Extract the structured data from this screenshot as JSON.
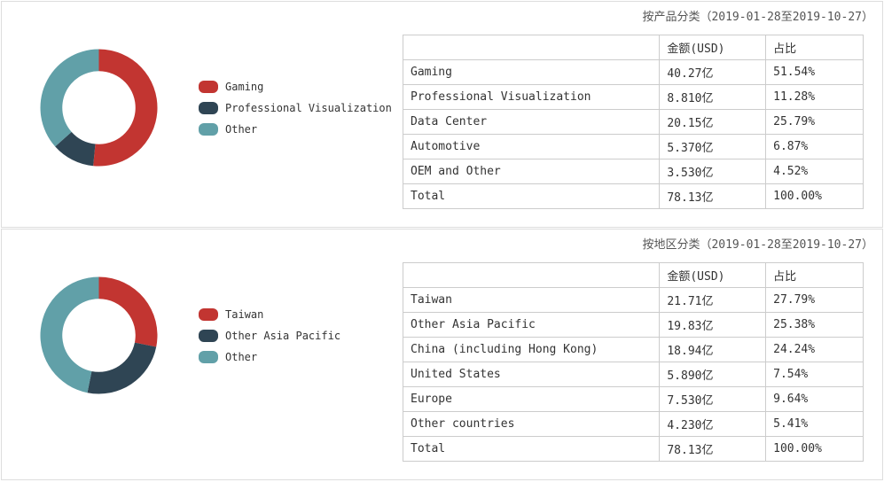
{
  "chart_data": [
    {
      "type": "pie",
      "title": "按产品分类（2019-01-28至2019-10-27）",
      "series": [
        {
          "name": "Gaming",
          "value": 40.27,
          "pct": 51.54,
          "color": "#c23531"
        },
        {
          "name": "Professional Visualization",
          "value": 8.81,
          "pct": 11.28,
          "color": "#2f4554"
        },
        {
          "name": "Data Center",
          "value": 20.15,
          "pct": 25.79,
          "color": "#61a0a8"
        },
        {
          "name": "Automotive",
          "value": 5.37,
          "pct": 6.87,
          "color": "#61a0a8"
        },
        {
          "name": "OEM and Other",
          "value": 3.53,
          "pct": 4.52,
          "color": "#61a0a8"
        }
      ],
      "visible_slices": [
        {
          "name": "Gaming",
          "pct": 51.54,
          "color": "#c23531"
        },
        {
          "name": "Professional Visualization",
          "pct": 11.28,
          "color": "#2f4554"
        },
        {
          "name": "Other",
          "pct": 37.18,
          "color": "#61a0a8"
        }
      ]
    },
    {
      "type": "pie",
      "title": "按地区分类（2019-01-28至2019-10-27）",
      "series": [
        {
          "name": "Taiwan",
          "value": 21.71,
          "pct": 27.79,
          "color": "#c23531"
        },
        {
          "name": "Other Asia Pacific",
          "value": 19.83,
          "pct": 25.38,
          "color": "#2f4554"
        },
        {
          "name": "China (including Hong Kong)",
          "value": 18.94,
          "pct": 24.24,
          "color": "#61a0a8"
        },
        {
          "name": "United States",
          "value": 5.89,
          "pct": 7.54,
          "color": "#61a0a8"
        },
        {
          "name": "Europe",
          "value": 7.53,
          "pct": 9.64,
          "color": "#61a0a8"
        },
        {
          "name": "Other countries",
          "value": 4.23,
          "pct": 5.41,
          "color": "#61a0a8"
        }
      ],
      "visible_slices": [
        {
          "name": "Taiwan",
          "pct": 27.79,
          "color": "#c23531"
        },
        {
          "name": "Other Asia Pacific",
          "pct": 25.38,
          "color": "#2f4554"
        },
        {
          "name": "Other",
          "pct": 46.83,
          "color": "#61a0a8"
        }
      ]
    }
  ],
  "panels": [
    {
      "title": "按产品分类（2019-01-28至2019-10-27）",
      "legend": [
        "Gaming",
        "Professional Visualization",
        "Other"
      ],
      "headers": {
        "name": "",
        "amount": "金额(USD)",
        "pct": "占比"
      },
      "rows": [
        {
          "name": "Gaming",
          "amount": "40.27亿",
          "pct": "51.54%"
        },
        {
          "name": "Professional Visualization",
          "amount": "8.810亿",
          "pct": "11.28%"
        },
        {
          "name": "Data Center",
          "amount": "20.15亿",
          "pct": "25.79%"
        },
        {
          "name": "Automotive",
          "amount": "5.370亿",
          "pct": "6.87%"
        },
        {
          "name": "OEM and Other",
          "amount": "3.530亿",
          "pct": "4.52%"
        },
        {
          "name": "Total",
          "amount": "78.13亿",
          "pct": "100.00%"
        }
      ]
    },
    {
      "title": "按地区分类（2019-01-28至2019-10-27）",
      "legend": [
        "Taiwan",
        "Other Asia Pacific",
        "Other"
      ],
      "headers": {
        "name": "",
        "amount": "金额(USD)",
        "pct": "占比"
      },
      "rows": [
        {
          "name": "Taiwan",
          "amount": "21.71亿",
          "pct": "27.79%"
        },
        {
          "name": "Other Asia Pacific",
          "amount": "19.83亿",
          "pct": "25.38%"
        },
        {
          "name": "China (including Hong Kong)",
          "amount": "18.94亿",
          "pct": "24.24%"
        },
        {
          "name": "United States",
          "amount": "5.890亿",
          "pct": "7.54%"
        },
        {
          "name": "Europe",
          "amount": "7.530亿",
          "pct": "9.64%"
        },
        {
          "name": "Other countries",
          "amount": "4.230亿",
          "pct": "5.41%"
        },
        {
          "name": "Total",
          "amount": "78.13亿",
          "pct": "100.00%"
        }
      ]
    }
  ]
}
